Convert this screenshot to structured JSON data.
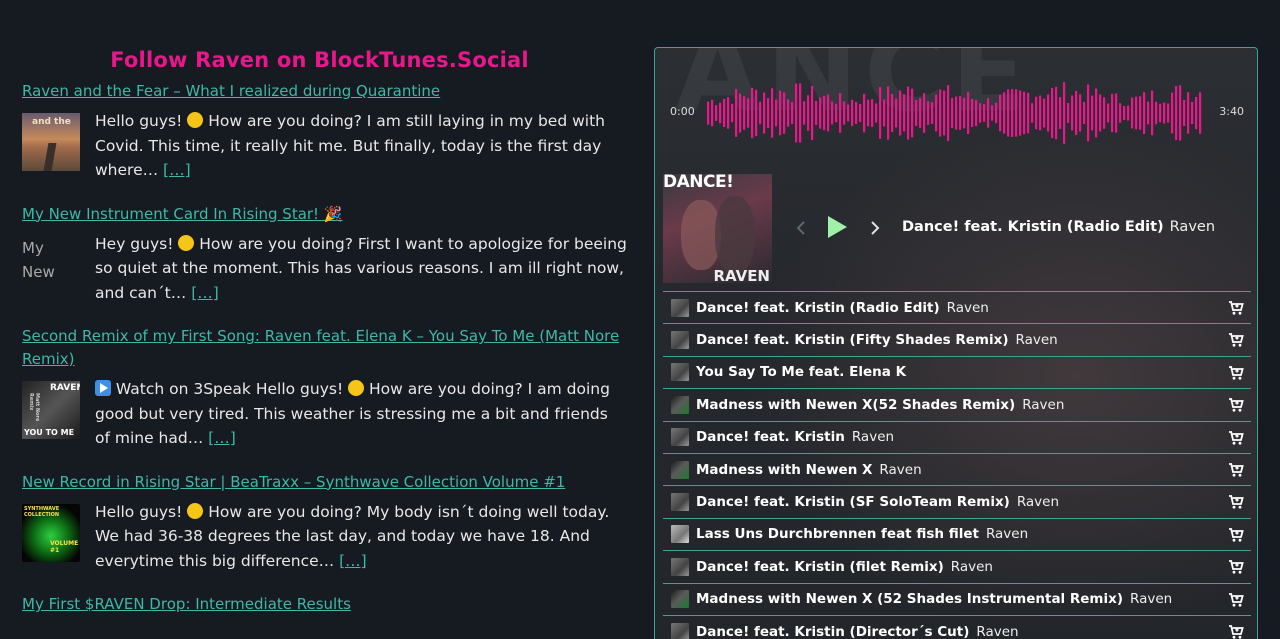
{
  "feed": {
    "title": "Follow Raven on BlockTunes.Social",
    "posts": [
      {
        "link": "Raven and the Fear – What I realized during Quarantine",
        "excerpt_a": "Hello guys! ",
        "excerpt_b": " How are you doing? I am still laying in my bed with Covid. This time, it really hit me. But finally, today is the first day where… ",
        "more": "[…]",
        "thumb_text": "and the"
      },
      {
        "link": "My New Instrument Card In Rising Star! 🎉",
        "excerpt_a": "Hey guys! ",
        "excerpt_b": " How are you doing? First I want to apologize for beeing so quiet at the moment. This has various reasons. I am ill right now, and can´t… ",
        "more": "[…]",
        "thumb_alt": "My New"
      },
      {
        "link": "Second Remix of my First Song: Raven feat. Elena K – You Say To Me (Matt Nore Remix)",
        "excerpt_a": " Watch on 3Speak Hello guys! ",
        "excerpt_b": " How are you doing? I am doing good but very tired. This weather is stressing me a bit and friends of mine had… ",
        "more": "[…]",
        "thumb_top": "RAVEN",
        "thumb_side": "Matt Nore Remix",
        "thumb_bottom": "YOU TO ME"
      },
      {
        "link": "New Record in Rising Star | BeaTraxx – Synthwave Collection Volume #1",
        "excerpt_a": "Hello guys! ",
        "excerpt_b": " How are you doing? My body isn´t doing well today. We had 36-38 degrees the last day, and today we have 18. And everytime this big difference… ",
        "more": "[…]",
        "thumb_top": "SYNTHWAVE COLLECTION",
        "thumb_bottom": "VOLUME #1"
      },
      {
        "link": "My First $RAVEN Drop: Intermediate Results"
      }
    ]
  },
  "player": {
    "time_start": "0:00",
    "time_end": "3:40",
    "accent_color": "#e8188c",
    "border_color": "#3aa596",
    "cover_title": "DANCE!",
    "cover_artist": "RAVEN",
    "now_playing": {
      "title": "Dance! feat. Kristin (Radio Edit)",
      "artist": "Raven"
    },
    "tracks": [
      {
        "title": "Dance! feat. Kristin (Radio Edit)",
        "artist": "Raven",
        "thumb": "gray"
      },
      {
        "title": "Dance! feat. Kristin (Fifty Shades Remix)",
        "artist": "Raven",
        "thumb": "gray"
      },
      {
        "title": "You Say To Me feat. Elena K",
        "artist": "",
        "thumb": "gray"
      },
      {
        "title": "Madness with Newen X(52 Shades Remix)",
        "artist": "Raven",
        "thumb": "green"
      },
      {
        "title": "Dance! feat. Kristin",
        "artist": "Raven",
        "thumb": "gray"
      },
      {
        "title": "Madness with Newen X",
        "artist": "Raven",
        "thumb": "green"
      },
      {
        "title": "Dance! feat. Kristin (SF SoloTeam Remix)",
        "artist": "Raven",
        "thumb": "gray"
      },
      {
        "title": "Lass Uns Durchbrennen feat fish filet",
        "artist": "Raven",
        "thumb": "light"
      },
      {
        "title": "Dance! feat. Kristin (filet Remix)",
        "artist": "Raven",
        "thumb": "gray"
      },
      {
        "title": "Madness with Newen X (52 Shades Instrumental Remix)",
        "artist": "Raven",
        "thumb": "green"
      },
      {
        "title": "Dance! feat. Kristin (Director´s Cut)",
        "artist": "Raven",
        "thumb": "gray"
      }
    ]
  }
}
